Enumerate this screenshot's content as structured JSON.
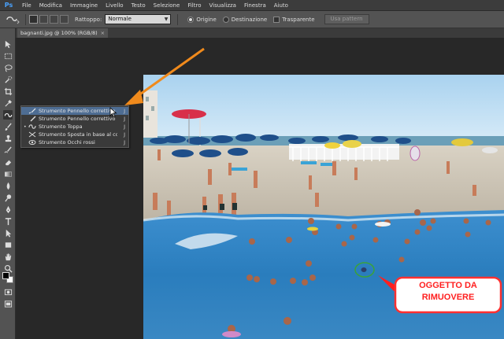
{
  "app": {
    "logo": "Ps"
  },
  "menu": [
    "File",
    "Modifica",
    "Immagine",
    "Livello",
    "Testo",
    "Selezione",
    "Filtro",
    "Visualizza",
    "Finestra",
    "Aiuto"
  ],
  "options": {
    "patch_label": "Rattoppo:",
    "patch_value": "Normale",
    "source_label": "Origine",
    "dest_label": "Destinazione",
    "transparent_label": "Trasparente",
    "use_pattern_label": "Usa pattern",
    "source_selected": true
  },
  "document": {
    "tab_label": "bagnanti.jpg @ 100% (RGB/8)",
    "close_glyph": "×"
  },
  "flyout": {
    "items": [
      {
        "label": "Strumento Pennello correttivo al volo",
        "key": "J",
        "highlighted": true,
        "current": false,
        "icon": "spot-healing-brush-icon"
      },
      {
        "label": "Strumento Pennello correttivo",
        "key": "J",
        "highlighted": false,
        "current": false,
        "icon": "healing-brush-icon"
      },
      {
        "label": "Strumento Toppa",
        "key": "J",
        "highlighted": false,
        "current": true,
        "icon": "patch-icon"
      },
      {
        "label": "Strumento Sposta in base al contenuto",
        "key": "J",
        "highlighted": false,
        "current": false,
        "icon": "content-aware-move-icon"
      },
      {
        "label": "Strumento Occhi rossi",
        "key": "J",
        "highlighted": false,
        "current": false,
        "icon": "red-eye-icon"
      }
    ],
    "bullet": "•"
  },
  "annotation": {
    "line1": "OGGETTO DA",
    "line2": "RIMUOVERE",
    "color": "#ff2020",
    "arrow_color": "#f08a1c",
    "circle_color": "#3aa23a"
  },
  "colors": {
    "menubar": "#3c3c3c",
    "optionsbar": "#535353",
    "workspace": "#282828",
    "highlight": "#4e6d93"
  }
}
